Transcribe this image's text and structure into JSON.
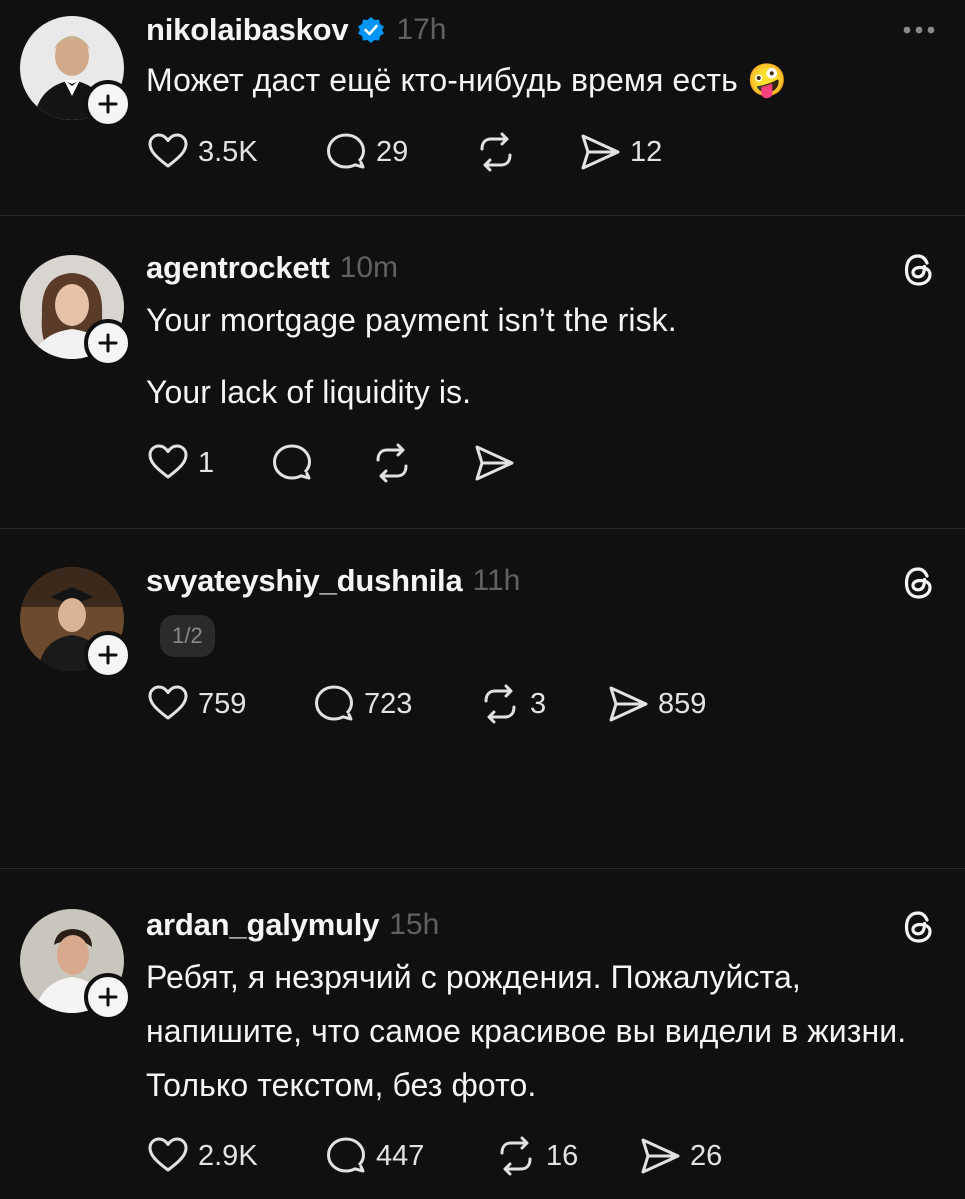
{
  "colors": {
    "background": "#101010",
    "text_primary": "#f3f5f7",
    "text_secondary": "#616161",
    "divider": "#2a2a2a",
    "verified_blue": "#0095f6"
  },
  "icons": {
    "like": "heart-icon",
    "reply": "comment-bubble-icon",
    "repost": "repost-arrows-icon",
    "share": "send-paper-plane-icon",
    "more": "more-dots-icon",
    "threads": "threads-logo-icon",
    "follow": "plus-icon",
    "verified": "verified-badge-icon"
  },
  "posts": [
    {
      "username": "nikolaibaskov",
      "verified": true,
      "time": "17h",
      "top_right": "more",
      "paragraphs": [
        "Может даст ещё кто-нибудь время есть 🤪"
      ],
      "likes": "3.5K",
      "replies": "29",
      "reposts": "",
      "shares": "12"
    },
    {
      "username": "agentrockett",
      "verified": false,
      "time": "10m",
      "top_right": "threads",
      "paragraphs": [
        "Your mortgage payment isn’t the risk.",
        "Your lack of liquidity is."
      ],
      "likes": "1",
      "replies": "",
      "reposts": "",
      "shares": ""
    },
    {
      "username": "svyateyshiy_dushnila",
      "verified": false,
      "time": "11h",
      "top_right": "threads",
      "paragraphs": [
        ""
      ],
      "pager": "1/2",
      "likes": "759",
      "replies": "723",
      "reposts": "3",
      "shares": "859"
    },
    {
      "username": "ardan_galymuly",
      "verified": false,
      "time": "15h",
      "top_right": "threads",
      "paragraphs": [
        "Ребят, я незрячий с рождения. Пожалуйста, напишите, что самое красивое вы видели в жизни. Только текстом, без фото."
      ],
      "likes": "2.9K",
      "replies": "447",
      "reposts": "16",
      "shares": "26"
    }
  ]
}
